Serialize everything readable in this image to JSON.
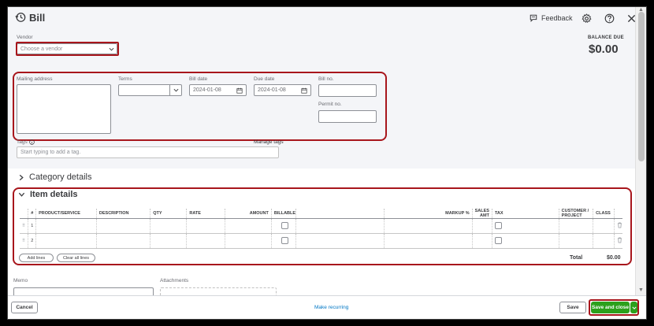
{
  "header": {
    "title": "Bill",
    "feedback_label": "Feedback"
  },
  "vendor": {
    "label": "Vendor",
    "placeholder": "Choose a vendor"
  },
  "balance": {
    "label": "BALANCE DUE",
    "amount": "$0.00"
  },
  "fields": {
    "mailing_address_label": "Mailing address",
    "terms_label": "Terms",
    "bill_date_label": "Bill date",
    "bill_date_value": "2024-01-08",
    "due_date_label": "Due date",
    "due_date_value": "2024-01-08",
    "bill_no_label": "Bill no.",
    "permit_no_label": "Permit no."
  },
  "tags": {
    "label": "Tags",
    "manage_label": "Manage tags",
    "placeholder": "Start typing to add a tag."
  },
  "sections": {
    "category_details": "Category details",
    "item_details": "Item details"
  },
  "item_table": {
    "columns": [
      "#",
      "PRODUCT/SERVICE",
      "DESCRIPTION",
      "QTY",
      "RATE",
      "AMOUNT",
      "BILLABLE",
      "MARKUP %",
      "SALES AMT",
      "TAX",
      "CUSTOMER / PROJECT",
      "CLASS"
    ],
    "rows": [
      {
        "num": "1"
      },
      {
        "num": "2"
      }
    ],
    "add_lines_label": "Add lines",
    "clear_all_lines_label": "Clear all lines",
    "total_label": "Total",
    "total_value": "$0.00"
  },
  "bottom": {
    "memo_label": "Memo",
    "attachments_label": "Attachments"
  },
  "footer": {
    "cancel_label": "Cancel",
    "make_recurring_label": "Make recurring",
    "save_label": "Save",
    "save_close_label": "Save and close"
  },
  "colors": {
    "annotation_red": "#a8161c",
    "primary_green": "#2ca01c",
    "link_blue": "#0077c5"
  }
}
